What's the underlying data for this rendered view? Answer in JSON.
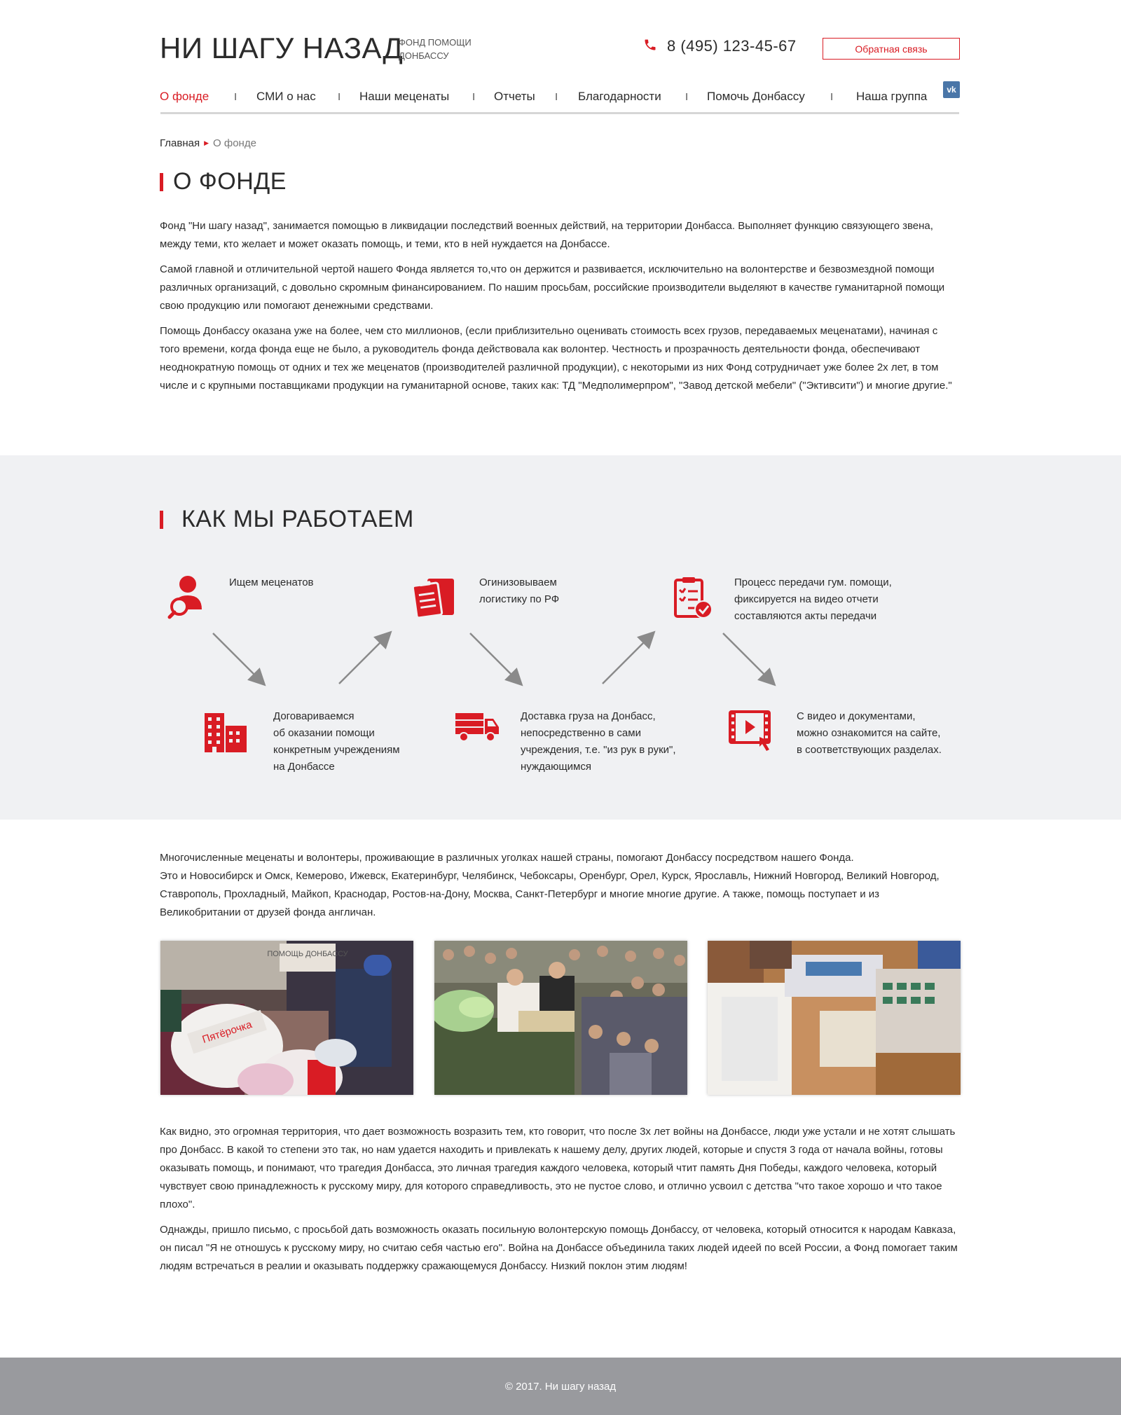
{
  "header": {
    "logo_title": "НИ ШАГУ НАЗАД",
    "logo_subtitle": "ФОНД ПОМОЩИ ДОНБАССУ",
    "phone": "8 (495) 123-45-67",
    "feedback_label": "Обратная связь",
    "vk_label": "vk"
  },
  "nav": {
    "items": [
      "О фонде",
      "СМИ о нас",
      "Наши меценаты",
      "Отчеты",
      "Благодарности",
      "Помочь Донбассу",
      "Наша группа"
    ],
    "separator": "I",
    "active_color": "#d91c24"
  },
  "breadcrumb": {
    "home": "Главная",
    "current": "О фонде"
  },
  "about": {
    "title": "О ФОНДЕ",
    "paragraphs": [
      "Фонд \"Ни шагу назад\", занимается помощью в ликвидации последствий военных действий, на территории Донбасса. Выполняет функцию связующего звена, между теми, кто желает и может оказать помощь, и теми, кто в ней нуждается на Донбассе.",
      "Самой главной и отличительной чертой нашего Фонда является то,что он держится и развивается, исключительно на волонтерстве и безвозмездной помощи различных организаций, с довольно скромным финансированием. По нашим просьбам, российские производители выделяют в качестве гуманитарной помощи свою продукцию или помогают денежными средствами.",
      "Помощь  Донбассу оказана уже на более, чем сто миллионов, (если приблизительно оценивать стоимость всех грузов, передаваемых меценатами), начиная с того времени, когда фонда еще не было, а руководитель фонда действовала как волонтер.  Честность и прозрачность деятельности фонда, обеспечивают неоднократную помощь от одних и тех же меценатов (производителей различной продукции), с некоторыми из них Фонд сотрудничает уже более 2х лет, в том числе и с крупными поставщиками продукции на гуманитарной основе, таких как: ТД \"Медполимерпром\", \"Завод детской мебели\" (\"Эктивсити\") и многие другие.\""
    ]
  },
  "how": {
    "title": "КАК МЫ РАБОТАЕМ",
    "steps": [
      {
        "icon": "search-people-icon",
        "text": [
          "Ищем меценатов"
        ]
      },
      {
        "icon": "buildings-icon",
        "text": [
          "Договариваемся",
          "об оказании помощи",
          "конкретным учреждениям",
          "на Донбассе"
        ]
      },
      {
        "icon": "clipboard-box-icon",
        "text": [
          "Огинизовываем",
          "логистику по РФ"
        ]
      },
      {
        "icon": "truck-icon",
        "text": [
          "Доставка груза на Донбасс,",
          "непосредственно в сами",
          "учреждения, т.е. \"из рук в руки\",",
          "нуждающимся"
        ]
      },
      {
        "icon": "checklist-icon",
        "text": [
          "Процесс передачи гум. помощи,",
          "фиксируется на видео отчети",
          "составляются акты передачи"
        ]
      },
      {
        "icon": "video-icon",
        "text": [
          "С видео и документами,",
          "можно ознакомится на сайте,",
          "в соответствующих разделах."
        ]
      }
    ],
    "accent": "#d91c24"
  },
  "volunteers": {
    "paragraph": "Многочисленные меценаты и волонтеры, проживающие в различных уголках нашей страны, помогают Донбассу посредством нашего Фонда.",
    "paragraph2": "Это и Новосибирск и Омск, Кемерово, Ижевск, Екатеринбург, Челябинск, Чебоксары, Оренбург, Орел, Курск, Ярославль, Нижний Новгород, Великий Новгород,  Ставрополь, Прохладный, Майкоп, Краснодар, Ростов-на-Дону, Москва, Санкт-Петербург и многие многие другие.  А также, помощь поступает и из Великобритании от  друзей фонда англичан."
  },
  "photos": {
    "photo1_sign": "ПОМОЩЬ ДОНБАССУ",
    "photo1_bag": "Пятёрочка"
  },
  "closing": {
    "paragraphs": [
      "Как видно, это огромная территория, что дает возможность возразить тем, кто говорит, что после 3х лет войны на Донбассе, люди уже устали и не хотят слышать про Донбасс. В какой то степени это так, но нам удается находить и привлекать к нашему делу, других людей, которые и спустя 3 года от начала войны, готовы оказывать помощь, и понимают, что трагедия Донбасса, это личная трагедия каждого человека, который чтит память Дня Победы, каждого человека, который чувствует свою принадлежность к русскому миру, для которого справедливость, это не пустое слово, и отлично усвоил с детства \"что такое хорошо и что такое плохо\".",
      "Однажды, пришло письмо, с просьбой дать возможность оказать посильную волонтерскую помощь Донбассу, от человека, который относится к народам Кавказа, он писал \"Я не отношусь к русскому миру, но считаю себя частью его\". Война на Донбассе объединила таких людей идеей по всей России, а Фонд помогает таким людям встречаться в реалии и оказывать поддержку сражающемуся Донбассу. Низкий поклон этим людям!"
    ]
  },
  "footer": {
    "copyright": "© 2017. Ни шагу назад"
  }
}
